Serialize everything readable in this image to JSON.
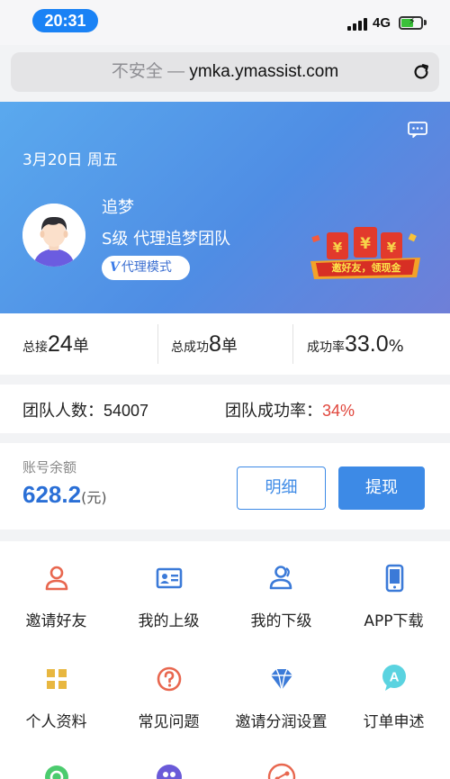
{
  "status_bar": {
    "time": "20:31",
    "network": "4G",
    "battery_color": "#3ac13a"
  },
  "address_bar": {
    "insecure_label": "不安全 —",
    "host": "ymka.ymassist.com"
  },
  "header": {
    "date": "3月20日 周五",
    "user_name": "追梦",
    "user_level": "S级 代理追梦团队",
    "mode_badge": "代理模式",
    "mode_mark": "V",
    "promo_text": "邀好友，领现金",
    "promo_envelope_symbols": [
      "¥",
      "¥",
      "¥"
    ]
  },
  "stats": {
    "total": {
      "label": "总接",
      "value": "24",
      "unit": "单"
    },
    "success": {
      "label": "总成功",
      "value": "8",
      "unit": "单"
    },
    "rate": {
      "label": "成功率",
      "value": "33.0",
      "unit": "%"
    }
  },
  "team": {
    "count_label": "团队人数：",
    "count_value": "54007",
    "rate_label": "团队成功率：",
    "rate_value": "34%"
  },
  "balance": {
    "label": "账号余额",
    "value": "628.2",
    "unit": "(元)",
    "detail_button": "明细",
    "withdraw_button": "提现"
  },
  "menu": [
    {
      "label": "邀请好友",
      "icon": "person-icon",
      "color": "#e8674f"
    },
    {
      "label": "我的上级",
      "icon": "id-card-icon",
      "color": "#3b7ad8"
    },
    {
      "label": "我的下级",
      "icon": "users-icon",
      "color": "#3b7ad8"
    },
    {
      "label": "APP下载",
      "icon": "phone-icon",
      "color": "#3b7ad8"
    },
    {
      "label": "个人资料",
      "icon": "grid-icon",
      "color": "#e8b740"
    },
    {
      "label": "常见问题",
      "icon": "question-icon",
      "color": "#e8674f"
    },
    {
      "label": "邀请分润设置",
      "icon": "diamond-icon",
      "color": "#3b7ad8"
    },
    {
      "label": "订单申述",
      "icon": "chat-a-icon",
      "color": "#5ad3e0"
    }
  ],
  "colors": {
    "accent": "#3d8ae6",
    "rate_red": "#e0463c"
  }
}
